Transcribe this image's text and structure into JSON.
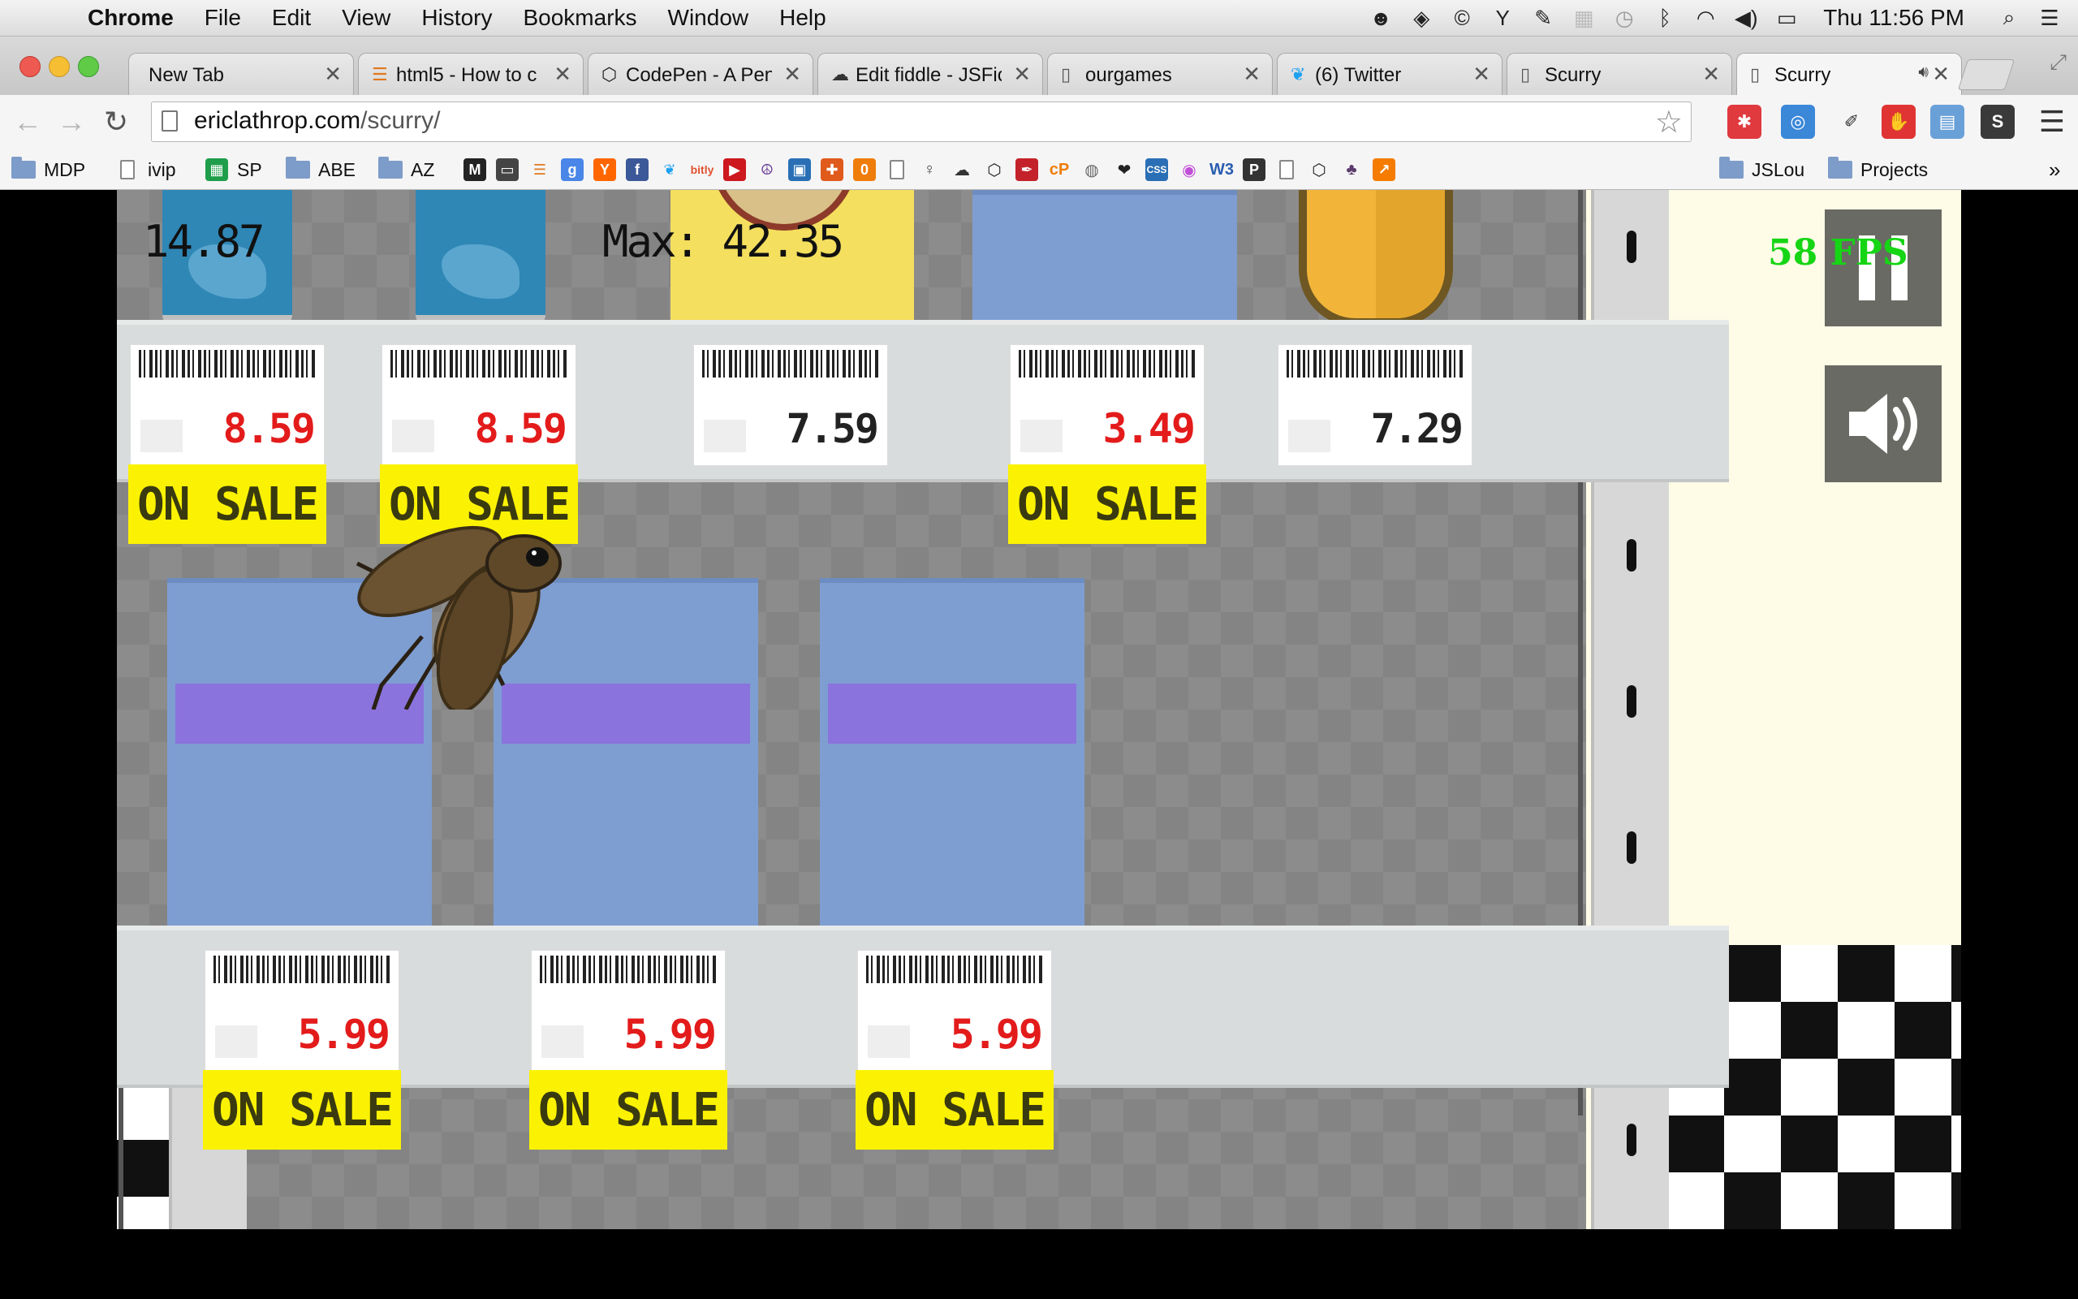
{
  "menubar": {
    "app": "Chrome",
    "menus": [
      "File",
      "Edit",
      "View",
      "History",
      "Bookmarks",
      "Window",
      "Help"
    ],
    "clock": "Thu 11:56 PM"
  },
  "tabs": [
    {
      "title": "New Tab",
      "icon": "none"
    },
    {
      "title": "html5 - How to c",
      "icon": "stackoverflow-icon"
    },
    {
      "title": "CodePen - A Pen",
      "icon": "codepen-icon"
    },
    {
      "title": "Edit fiddle - JSFic",
      "icon": "jsfiddle-icon"
    },
    {
      "title": "ourgames",
      "icon": "page-icon"
    },
    {
      "title": "(6) Twitter",
      "icon": "twitter-icon"
    },
    {
      "title": "Scurry",
      "icon": "page-icon"
    },
    {
      "title": "Scurry",
      "icon": "page-icon",
      "active": true,
      "audio": true
    }
  ],
  "toolbar": {
    "url_host": "ericlathrop.com",
    "url_path": "/scurry/"
  },
  "bookmarks": [
    {
      "label": "MDP",
      "icon": "folder"
    },
    {
      "label": "ivip",
      "icon": "page"
    },
    {
      "label": "SP",
      "icon": "sheets"
    },
    {
      "label": "ABE",
      "icon": "folder"
    },
    {
      "label": "AZ",
      "icon": "folder"
    },
    {
      "label": "JSLou",
      "icon": "folder"
    },
    {
      "label": "Projects",
      "icon": "folder"
    }
  ],
  "game": {
    "score": "14.87",
    "max_score": "Max: 42.35",
    "fps": "58 FPS",
    "top_prices": [
      {
        "price": "8.59",
        "on_sale": true
      },
      {
        "price": "8.59",
        "on_sale": true
      },
      {
        "price": "7.59",
        "on_sale": false
      },
      {
        "price": "3.49",
        "on_sale": true
      },
      {
        "price": "7.29",
        "on_sale": false
      }
    ],
    "bottom_prices": [
      {
        "price": "5.99",
        "on_sale": true
      },
      {
        "price": "5.99",
        "on_sale": true
      },
      {
        "price": "5.99",
        "on_sale": true
      }
    ],
    "sale_label": "ON SALE",
    "colors": {
      "sale_price": "#e31b1b",
      "sale_banner": "#fbf203",
      "fps": "#15d515"
    }
  }
}
